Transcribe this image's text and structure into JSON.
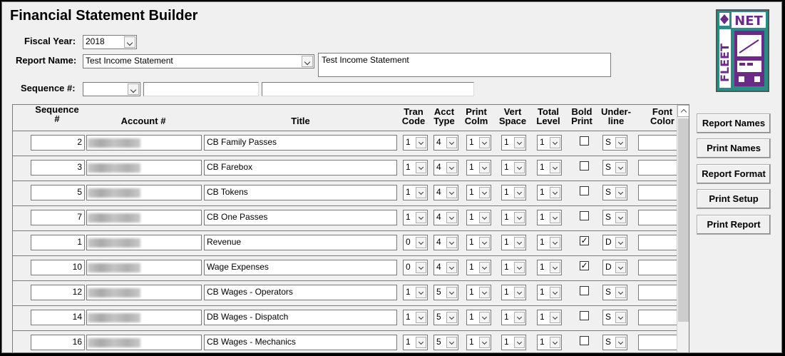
{
  "window": {
    "title": "Financial Statement Builder"
  },
  "form": {
    "fiscal_year_label": "Fiscal Year:",
    "fiscal_year_value": "2018",
    "report_name_label": "Report Name:",
    "report_name_value": "Test Income Statement",
    "report_name_desc": "Test Income Statement",
    "sequence_label": "Sequence #:",
    "sequence_value": "",
    "sequence_text1": "",
    "sequence_text2": ""
  },
  "logo": {
    "text_top": "NET",
    "text_side": "FLEET"
  },
  "grid": {
    "headers": {
      "sequence": "Sequence #",
      "account": "Account #",
      "title": "Title",
      "tran_code": "Tran Code",
      "acct_type": "Acct Type",
      "print_colm": "Print Colm",
      "vert_space": "Vert Space",
      "total_level": "Total Level",
      "bold_print": "Bold Print",
      "underline": "Under-line",
      "font_color": "Font Color"
    },
    "rows": [
      {
        "seq": "2",
        "title": "CB Family Passes",
        "tran": "1",
        "acct": "4",
        "colm": "1",
        "vert": "1",
        "total": "1",
        "bold": "",
        "under": "S"
      },
      {
        "seq": "3",
        "title": "CB Farebox",
        "tran": "1",
        "acct": "4",
        "colm": "1",
        "vert": "1",
        "total": "1",
        "bold": "",
        "under": "S"
      },
      {
        "seq": "5",
        "title": "CB Tokens",
        "tran": "1",
        "acct": "4",
        "colm": "1",
        "vert": "1",
        "total": "1",
        "bold": "",
        "under": "S"
      },
      {
        "seq": "7",
        "title": "CB One Passes",
        "tran": "1",
        "acct": "4",
        "colm": "1",
        "vert": "1",
        "total": "1",
        "bold": "",
        "under": "S"
      },
      {
        "seq": "1",
        "title": "Revenue",
        "tran": "0",
        "acct": "4",
        "colm": "1",
        "vert": "1",
        "total": "1",
        "bold": "✓",
        "under": "D"
      },
      {
        "seq": "10",
        "title": "Wage Expenses",
        "tran": "0",
        "acct": "4",
        "colm": "1",
        "vert": "1",
        "total": "1",
        "bold": "✓",
        "under": "D"
      },
      {
        "seq": "12",
        "title": "CB Wages - Operators",
        "tran": "1",
        "acct": "5",
        "colm": "1",
        "vert": "1",
        "total": "1",
        "bold": "",
        "under": "S"
      },
      {
        "seq": "14",
        "title": "DB Wages - Dispatch",
        "tran": "1",
        "acct": "5",
        "colm": "1",
        "vert": "1",
        "total": "1",
        "bold": "",
        "under": "S"
      },
      {
        "seq": "16",
        "title": "CB Wages - Mechanics",
        "tran": "1",
        "acct": "5",
        "colm": "1",
        "vert": "1",
        "total": "1",
        "bold": "",
        "under": "S"
      }
    ]
  },
  "buttons": {
    "report_names": "Report Names",
    "print_names": "Print Names",
    "report_format": "Report Format",
    "print_setup": "Print Setup",
    "print_report": "Print Report"
  }
}
